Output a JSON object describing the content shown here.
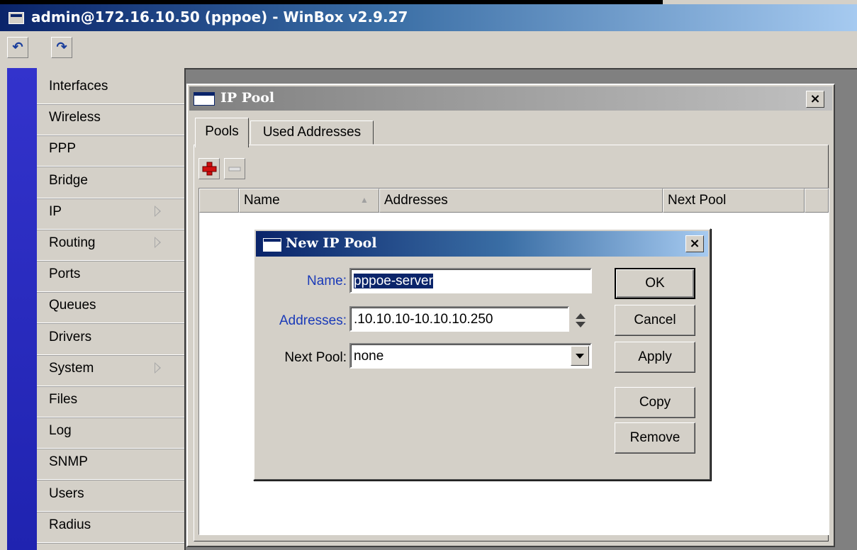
{
  "window": {
    "title": "admin@172.16.10.50 (pppoe) - WinBox v2.9.27"
  },
  "toolbar": {
    "undo_icon": "undo-icon",
    "redo_icon": "redo-icon"
  },
  "sidebar": {
    "items": [
      {
        "label": "Interfaces",
        "submenu": false
      },
      {
        "label": "Wireless",
        "submenu": false
      },
      {
        "label": "PPP",
        "submenu": false
      },
      {
        "label": "Bridge",
        "submenu": false
      },
      {
        "label": "IP",
        "submenu": true
      },
      {
        "label": "Routing",
        "submenu": true
      },
      {
        "label": "Ports",
        "submenu": false
      },
      {
        "label": "Queues",
        "submenu": false
      },
      {
        "label": "Drivers",
        "submenu": false
      },
      {
        "label": "System",
        "submenu": true
      },
      {
        "label": "Files",
        "submenu": false
      },
      {
        "label": "Log",
        "submenu": false
      },
      {
        "label": "SNMP",
        "submenu": false
      },
      {
        "label": "Users",
        "submenu": false
      },
      {
        "label": "Radius",
        "submenu": false
      }
    ]
  },
  "ip_pool": {
    "title": "IP Pool",
    "close_label": "×",
    "tabs": [
      "Pools",
      "Used Addresses"
    ],
    "columns": [
      "Name",
      "Addresses",
      "Next Pool"
    ],
    "sort_column": "Name"
  },
  "dialog": {
    "title": "New IP Pool",
    "close_label": "×",
    "name_label": "Name:",
    "name_value": "pppoe-server",
    "addresses_label": "Addresses:",
    "addresses_value": ".10.10.10-10.10.10.250",
    "next_pool_label": "Next Pool:",
    "next_pool_value": "none",
    "buttons": {
      "ok": "OK",
      "cancel": "Cancel",
      "apply": "Apply",
      "copy": "Copy",
      "remove": "Remove"
    }
  },
  "colors": {
    "title_active": "#0a246a",
    "label_blue": "#1a3ab8",
    "sidebar_strip": "#2a2ec0",
    "add_red": "#d01010"
  }
}
